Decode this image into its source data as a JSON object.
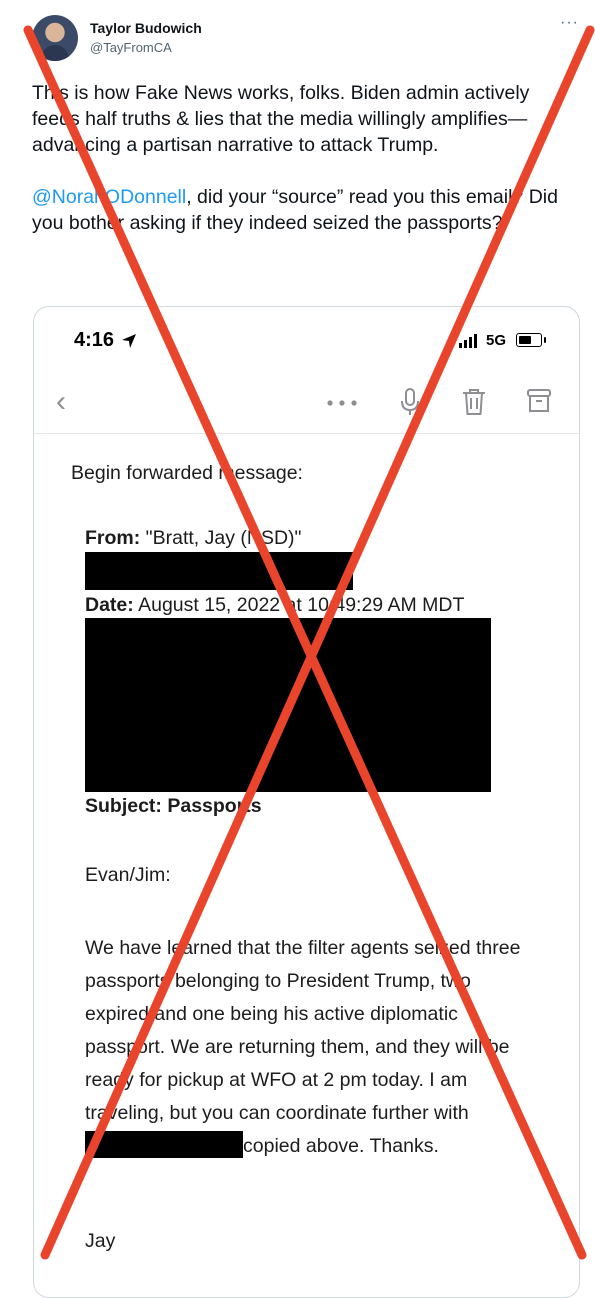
{
  "tweet": {
    "author_name": "Taylor Budowich",
    "author_handle": "@TayFromCA",
    "more_label": "···",
    "text_1": "This is how Fake News works, folks. Biden admin actively feeds half truths & lies that the media willingly amplifies—advancing a partisan narrative to attack Trump.",
    "mention": "@NorahODonnell",
    "text_2": ", did your “source” read you this email? Did you bother asking if they indeed seized the passports?"
  },
  "phone": {
    "time": "4:16",
    "network": "5G"
  },
  "toolbar": {
    "back_label": "‹",
    "icons": [
      "more-icon",
      "microphone-icon",
      "trash-icon",
      "archive-icon"
    ]
  },
  "email": {
    "forward_label": "Begin forwarded message:",
    "from_label": "From:",
    "from_value": "\"Bratt, Jay (NSD)\"",
    "date_label": "Date:",
    "date_value": "August 15, 2022 at 10:49:29 AM MDT",
    "subject_label": "Subject:",
    "subject_value": "Passports",
    "greeting": "Evan/Jim:",
    "body_1": "We have learned that the filter agents seized three passports belonging to President Trump, two expired and one being his active diplomatic passport. We are returning them, and they will be ready for pickup at WFO at 2 pm today. I am traveling, but you can coordinate further with",
    "body_2": "copied above. Thanks.",
    "signoff": "Jay"
  },
  "overlay": {
    "cross_color": "#e8452c"
  }
}
